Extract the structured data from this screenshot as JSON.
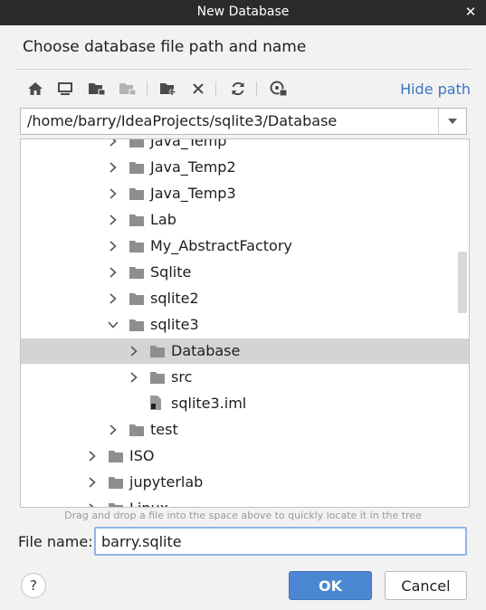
{
  "window": {
    "title": "New Database"
  },
  "dialog": {
    "heading": "Choose database file path and name",
    "hide_path_label": "Hide path",
    "path": "/home/barry/IdeaProjects/sqlite3/Database",
    "hint": "Drag and drop a file into the space above to quickly locate it in the tree"
  },
  "toolbar": {
    "icons": [
      "home-icon",
      "desktop-icon",
      "project-folder-icon",
      "module-folder-icon",
      "new-folder-icon",
      "delete-icon",
      "refresh-icon",
      "show-hidden-icon"
    ]
  },
  "tree": {
    "items": [
      {
        "label": "Java_Temp",
        "expanded": false,
        "type": "folder",
        "level": 2
      },
      {
        "label": "Java_Temp2",
        "expanded": false,
        "type": "folder",
        "level": 2
      },
      {
        "label": "Java_Temp3",
        "expanded": false,
        "type": "folder",
        "level": 2
      },
      {
        "label": "Lab",
        "expanded": false,
        "type": "folder",
        "level": 2
      },
      {
        "label": "My_AbstractFactory",
        "expanded": false,
        "type": "folder",
        "level": 2
      },
      {
        "label": "Sqlite",
        "expanded": false,
        "type": "folder",
        "level": 2
      },
      {
        "label": "sqlite2",
        "expanded": false,
        "type": "folder",
        "level": 2
      },
      {
        "label": "sqlite3",
        "expanded": true,
        "type": "folder",
        "level": 2
      },
      {
        "label": "Database",
        "expanded": false,
        "type": "folder",
        "level": 3,
        "selected": true
      },
      {
        "label": "src",
        "expanded": false,
        "type": "folder",
        "level": 3
      },
      {
        "label": "sqlite3.iml",
        "expanded": false,
        "type": "file",
        "level": 3
      },
      {
        "label": "test",
        "expanded": false,
        "type": "folder",
        "level": 2
      },
      {
        "label": "ISO",
        "expanded": false,
        "type": "folder",
        "level": 1
      },
      {
        "label": "jupyterlab",
        "expanded": false,
        "type": "folder",
        "level": 1
      },
      {
        "label": "Linux",
        "expanded": false,
        "type": "folder",
        "level": 1
      }
    ]
  },
  "form": {
    "file_name_label": "File name:",
    "file_name_value": "barry.sqlite"
  },
  "buttons": {
    "help": "?",
    "ok": "OK",
    "cancel": "Cancel"
  },
  "colors": {
    "accent": "#4b87d3",
    "link": "#3a76c4",
    "selection": "#d4d4d4",
    "folder": "#8e8e8e"
  }
}
